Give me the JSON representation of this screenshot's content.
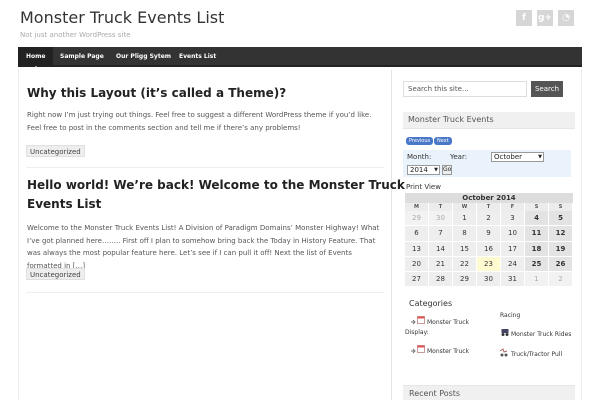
{
  "site": {
    "title": "Monster Truck Events List",
    "tagline": "Not just another WordPress site"
  },
  "social": [
    {
      "name": "facebook",
      "glyph": "f"
    },
    {
      "name": "google-plus",
      "glyph": "g+"
    },
    {
      "name": "rss",
      "glyph": "◔"
    }
  ],
  "nav": [
    "Home",
    "Sample Page",
    "Our Pligg Sytem",
    "Events List"
  ],
  "posts": [
    {
      "title": "Why this Layout (it’s called a Theme)?",
      "body": "Right now I’m just trying out things. Feel free to suggest a different WordPress theme if you’d like. Feel free to post in the comments section and tell me if there’s any problems!",
      "category": "Uncategorized"
    },
    {
      "title_line1": "Hello world! We’re back! Welcome to the Monster Truck",
      "title_line2": "Events List",
      "body": "Welcome to the Monster Truck Events List! A Division of Paradigm Domains’ Monster Highway! What I’ve got planned here…….. First off I plan to somehow bring back the Today in History Feature. That was always the most popular feature here. Let’s see if I can pull it off! Next the list of Events formatted in […]",
      "category": "Uncategorized"
    }
  ],
  "search": {
    "placeholder": "Search this site…",
    "button": "Search"
  },
  "events_widget": {
    "title": "Monster Truck Events",
    "prev": "Previous",
    "next": "Next",
    "month_label": "Month:",
    "year_label": "Year:",
    "month_value": "October",
    "year_value": "2014",
    "go": "Go",
    "print_view": "Print View"
  },
  "calendar": {
    "caption": "October 2014",
    "weekdays": [
      "M",
      "T",
      "W",
      "T",
      "F",
      "S",
      "S"
    ],
    "weeks": [
      [
        {
          "d": "29",
          "k": "other"
        },
        {
          "d": "30",
          "k": "other"
        },
        {
          "d": "1"
        },
        {
          "d": "2"
        },
        {
          "d": "3"
        },
        {
          "d": "4",
          "k": "event"
        },
        {
          "d": "5",
          "k": "event"
        }
      ],
      [
        {
          "d": "6"
        },
        {
          "d": "7"
        },
        {
          "d": "8"
        },
        {
          "d": "9"
        },
        {
          "d": "10"
        },
        {
          "d": "11",
          "k": "event"
        },
        {
          "d": "12",
          "k": "event"
        }
      ],
      [
        {
          "d": "13"
        },
        {
          "d": "14"
        },
        {
          "d": "15"
        },
        {
          "d": "16"
        },
        {
          "d": "17"
        },
        {
          "d": "18",
          "k": "event"
        },
        {
          "d": "19",
          "k": "event"
        }
      ],
      [
        {
          "d": "20"
        },
        {
          "d": "21"
        },
        {
          "d": "22"
        },
        {
          "d": "23",
          "k": "today"
        },
        {
          "d": "24"
        },
        {
          "d": "25",
          "k": "event"
        },
        {
          "d": "26",
          "k": "event"
        }
      ],
      [
        {
          "d": "27"
        },
        {
          "d": "28"
        },
        {
          "d": "29"
        },
        {
          "d": "30"
        },
        {
          "d": "31"
        },
        {
          "d": "1",
          "k": "other"
        },
        {
          "d": "2",
          "k": "other"
        }
      ]
    ]
  },
  "categories": {
    "title": "Categories",
    "items": [
      "Monster Truck",
      "Display:",
      "Monster Truck",
      "Racing",
      "Monster Truck Rides",
      "Truck/Tractor Pull"
    ]
  },
  "recent_posts": {
    "title": "Recent Posts"
  },
  "colors": {
    "nav_bg": "#333333",
    "accent_blue": "#4a78c8",
    "calendar_form_bg": "#eaf3fb",
    "today_bg": "#fffbd0"
  }
}
